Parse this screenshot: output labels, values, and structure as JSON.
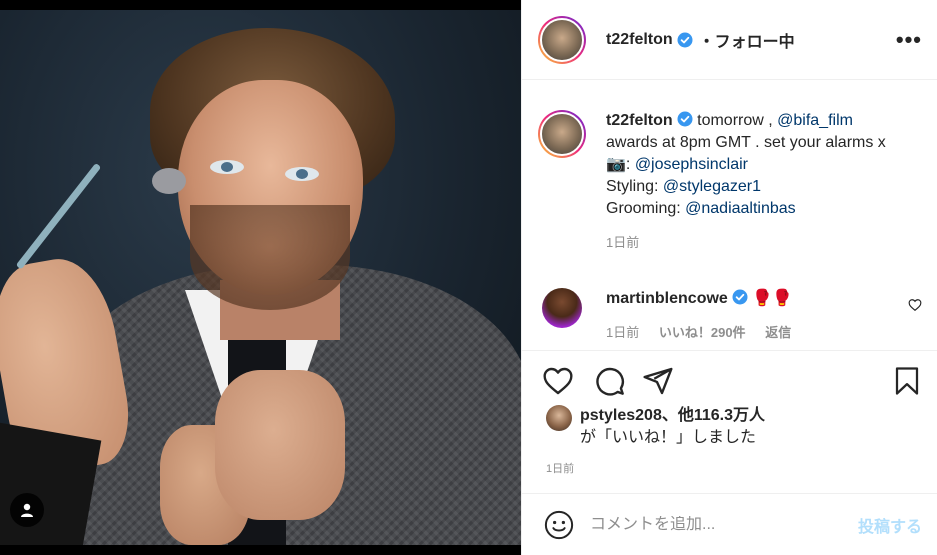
{
  "colors": {
    "accent": "#0095f6",
    "verified": "#3897f0",
    "link": "#00376b",
    "muted": "#8e8e8e",
    "text": "#262626",
    "post_disabled": "#b2dffc"
  },
  "header": {
    "username": "t22felton",
    "follow_label": "・フォロー中",
    "more_label": "•••",
    "avatar_icon": "profile-avatar",
    "verified_icon": "verified-badge-icon"
  },
  "photo": {
    "tag_icon": "user-tag-icon",
    "alt": ""
  },
  "caption": {
    "username": "t22felton",
    "line1_text": "tomorrow , ",
    "line1_mention": "@bifa_film",
    "line2_text": "awards at 8pm GMT . set your alarms x",
    "line3_prefix": "📷: ",
    "line3_mention": "@josephsinclair",
    "line4_prefix": "Styling: ",
    "line4_mention": "@stylegazer1",
    "line5_prefix": "Grooming: ",
    "line5_mention": "@nadiaaltinbas",
    "time": "1日前"
  },
  "comment": {
    "username": "martinblencowe",
    "text": "🥊🥊",
    "time": "1日前",
    "likes": "いいね！290件",
    "reply": "返信"
  },
  "actions": {
    "like_icon": "heart-icon",
    "comment_icon": "comment-bubble-icon",
    "share_icon": "paper-plane-icon",
    "save_icon": "bookmark-icon"
  },
  "likes": {
    "liker": "pstyles208",
    "others": "、他116.3万人",
    "suffix": "が「いいね！」しました"
  },
  "post_time": "1日前",
  "composer": {
    "emoji_icon": "smiley-icon",
    "placeholder": "コメントを追加...",
    "post_label": "投稿する"
  }
}
